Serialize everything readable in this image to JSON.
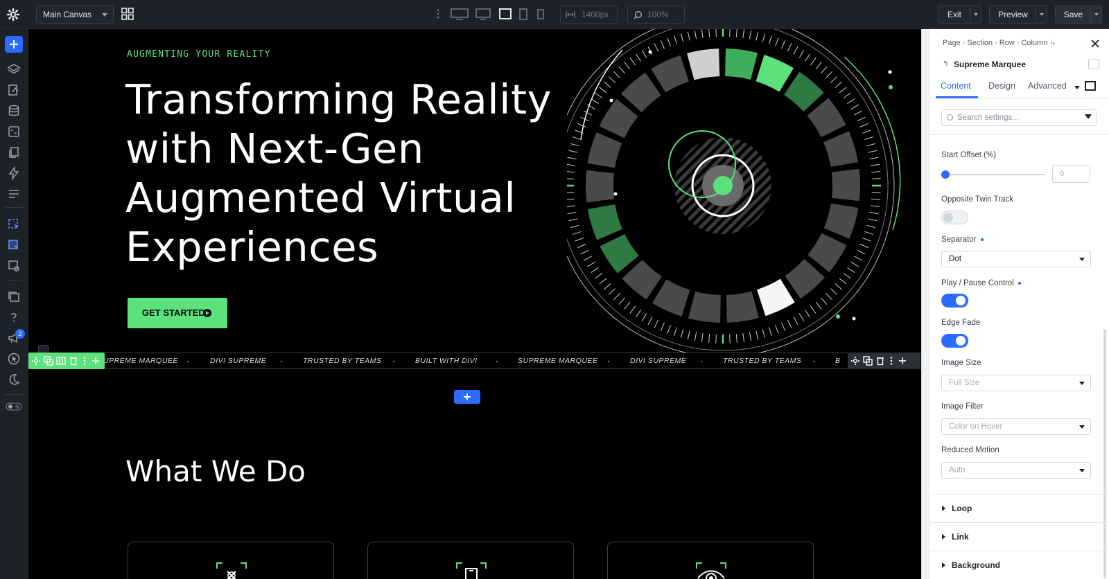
{
  "toolbar": {
    "canvas_name": "Main Canvas",
    "width_value": "1400px",
    "zoom_value": "100%",
    "exit_label": "Exit",
    "preview_label": "Preview",
    "save_label": "Save"
  },
  "leftbar": {
    "notification_count": "2"
  },
  "hero": {
    "eyebrow": "AUGMENTING YOUR REALITY",
    "title_line1": "Transforming Reality",
    "title_line2": "with Next-Gen",
    "title_line3": "Augmented Virtual",
    "title_line4": "Experiences",
    "cta_label": "GET STARTED"
  },
  "marquee": {
    "items": [
      "UPREME MARQUEE",
      "DIVI SUPREME",
      "TRUSTED BY TEAMS",
      "BUILT WITH DIVI",
      "SUPREME MARQUEE",
      "DIVI SUPREME",
      "TRUSTED BY TEAMS",
      "B"
    ]
  },
  "section": {
    "title": "What We Do"
  },
  "panel": {
    "breadcrumb": [
      "Page",
      "Section",
      "Row",
      "Column"
    ],
    "module_name": "Supreme Marquee",
    "tabs": [
      "Content",
      "Design",
      "Advanced"
    ],
    "search_placeholder": "Search settings...",
    "start_offset_label": "Start Offset (%)",
    "start_offset_value": "0",
    "opposite_twin_label": "Opposite Twin Track",
    "separator_label": "Separator",
    "separator_value": "Dot",
    "play_pause_label": "Play / Pause Control",
    "edge_fade_label": "Edge Fade",
    "image_size_label": "Image Size",
    "image_size_value": "Full Size",
    "image_filter_label": "Image Filter",
    "image_filter_value": "Color on Hover",
    "reduced_motion_label": "Reduced Motion",
    "reduced_motion_value": "Auto",
    "groups": [
      "Loop",
      "Link",
      "Background"
    ]
  },
  "colors": {
    "accent_green": "#5be27d",
    "accent_blue": "#2b6bff",
    "canvas_bg": "#000000"
  }
}
